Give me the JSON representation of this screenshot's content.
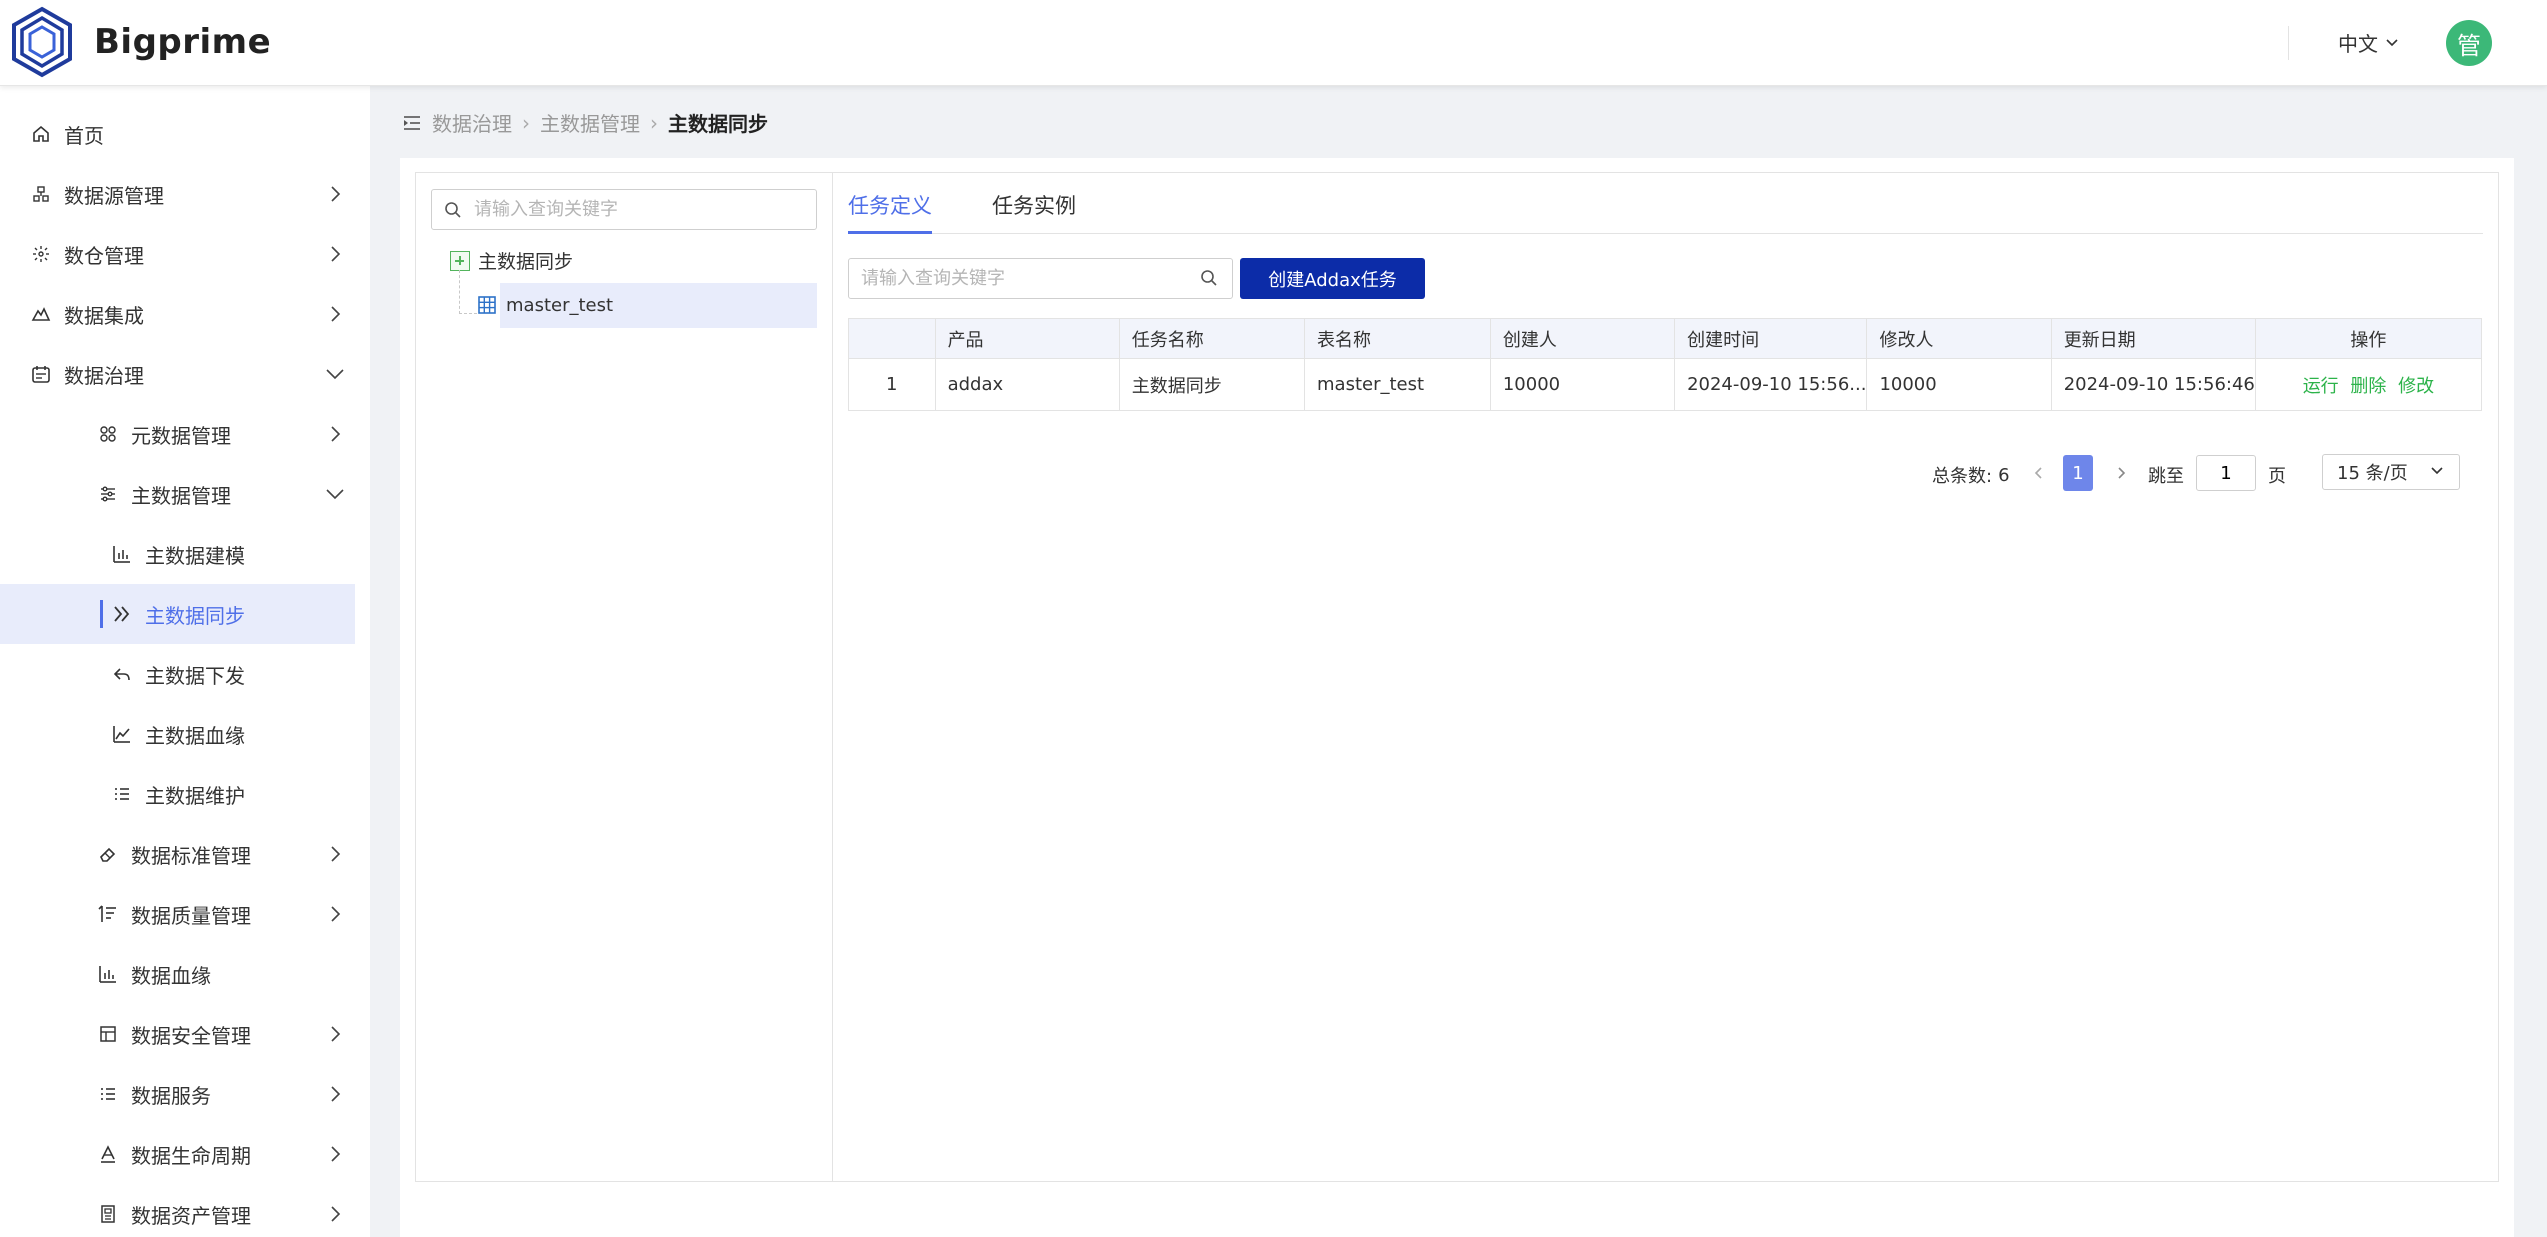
{
  "app": {
    "brand": "Bigprime",
    "language": "中文",
    "avatar_initial": "管",
    "colors": {
      "accent": "#4f6fe8",
      "primary_button": "#0c2ca8",
      "success": "#2cb34a",
      "avatar": "#3cb878"
    }
  },
  "sidebar": {
    "items": [
      {
        "label": "首页",
        "icon": "home-icon",
        "level": 0,
        "arrow": "none"
      },
      {
        "label": "数据源管理",
        "icon": "datasource-icon",
        "level": 0,
        "arrow": "right"
      },
      {
        "label": "数仓管理",
        "icon": "warehouse-icon",
        "level": 0,
        "arrow": "right"
      },
      {
        "label": "数据集成",
        "icon": "integration-icon",
        "level": 0,
        "arrow": "right"
      },
      {
        "label": "数据治理",
        "icon": "governance-icon",
        "level": 0,
        "arrow": "down"
      },
      {
        "label": "元数据管理",
        "icon": "metadata-icon",
        "level": 1,
        "arrow": "right"
      },
      {
        "label": "主数据管理",
        "icon": "sliders-icon",
        "level": 1,
        "arrow": "down"
      },
      {
        "label": "主数据建模",
        "icon": "bar-chart-icon",
        "level": 2,
        "arrow": "none"
      },
      {
        "label": "主数据同步",
        "icon": "double-chevron-icon",
        "level": 2,
        "arrow": "none",
        "active": true
      },
      {
        "label": "主数据下发",
        "icon": "reply-icon",
        "level": 2,
        "arrow": "none"
      },
      {
        "label": "主数据血缘",
        "icon": "line-chart-icon",
        "level": 2,
        "arrow": "none"
      },
      {
        "label": "主数据维护",
        "icon": "list-icon",
        "level": 2,
        "arrow": "none"
      },
      {
        "label": "数据标准管理",
        "icon": "eraser-icon",
        "level": 1,
        "arrow": "right"
      },
      {
        "label": "数据质量管理",
        "icon": "quality-icon",
        "level": 1,
        "arrow": "right"
      },
      {
        "label": "数据血缘",
        "icon": "bar-chart-icon",
        "level": 1,
        "arrow": "none"
      },
      {
        "label": "数据安全管理",
        "icon": "table-icon",
        "level": 1,
        "arrow": "right"
      },
      {
        "label": "数据服务",
        "icon": "list-icon",
        "level": 1,
        "arrow": "right"
      },
      {
        "label": "数据生命周期",
        "icon": "lifecycle-icon",
        "level": 1,
        "arrow": "right"
      },
      {
        "label": "数据资产管理",
        "icon": "asset-icon",
        "level": 1,
        "arrow": "right"
      }
    ]
  },
  "breadcrumb": {
    "items": [
      "数据治理",
      "主数据管理"
    ],
    "current": "主数据同步"
  },
  "tree": {
    "search_placeholder": "请输入查询关键字",
    "root_label": "主数据同步",
    "child_label": "master_test"
  },
  "tabs": [
    {
      "label": "任务定义",
      "active": true
    },
    {
      "label": "任务实例",
      "active": false
    }
  ],
  "toolbar": {
    "search_placeholder": "请输入查询关键字",
    "create_label": "创建Addax任务"
  },
  "table": {
    "headers": [
      "",
      "产品",
      "任务名称",
      "表名称",
      "创建人",
      "创建时间",
      "修改人",
      "更新日期",
      "操作"
    ],
    "rows": [
      {
        "index": "1",
        "product": "addax",
        "task_name": "主数据同步",
        "table_name": "master_test",
        "creator": "10000",
        "created_at": "2024-09-10 15:56...",
        "modifier": "10000",
        "updated_at": "2024-09-10 15:56:46",
        "actions": [
          "运行",
          "删除",
          "修改"
        ]
      }
    ]
  },
  "pagination": {
    "total_label": "总条数:",
    "total": "6",
    "current_page": "1",
    "jump_label": "跳至",
    "jump_value": "1",
    "page_unit": "页",
    "page_size": "15 条/页"
  }
}
